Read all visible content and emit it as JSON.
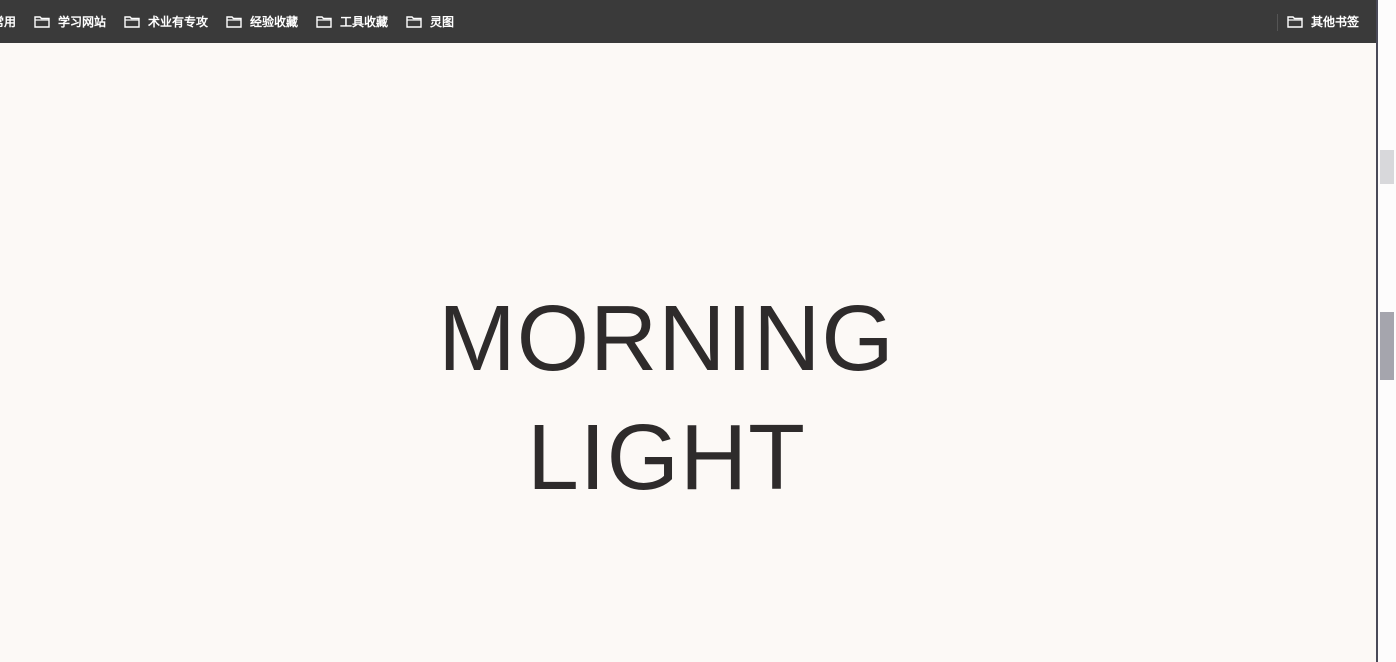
{
  "bookmarks_bar": {
    "items": [
      {
        "label": "常用",
        "icon": "folder-icon"
      },
      {
        "label": "学习网站",
        "icon": "folder-icon"
      },
      {
        "label": "术业有专攻",
        "icon": "folder-icon"
      },
      {
        "label": "经验收藏",
        "icon": "folder-icon"
      },
      {
        "label": "工具收藏",
        "icon": "folder-icon"
      },
      {
        "label": "灵图",
        "icon": "folder-icon"
      }
    ],
    "other_bookmarks": {
      "label": "其他书签",
      "icon": "folder-icon"
    }
  },
  "hero": {
    "line1": "MORNING",
    "line2": "LIGHT"
  },
  "colors": {
    "bar_bg": "#3a3a3a",
    "page_bg": "#fcf9f6",
    "hero_text": "#2e2b2b"
  }
}
